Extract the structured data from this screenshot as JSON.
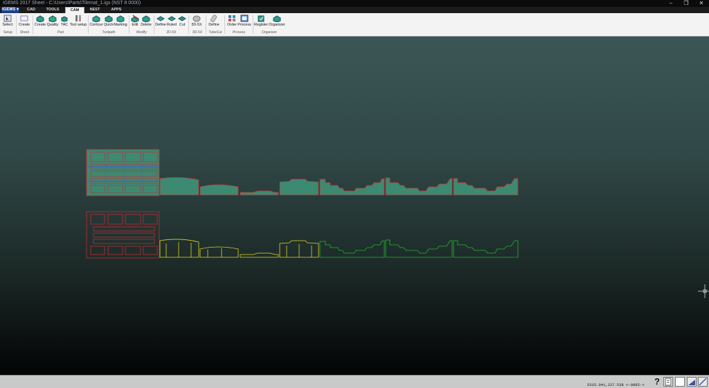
{
  "titlebar": {
    "title": "IGEMS 2017 Sheet - C:\\Users\\Parts\\Tilemat_1.igs (NST 8 0000)",
    "controls": [
      "–",
      "❐",
      "✕"
    ]
  },
  "app_menu": {
    "label": "IGEMS ▾"
  },
  "tabs": [
    "CAD",
    "TOOLS",
    "CAM",
    "NEST",
    "APPS"
  ],
  "active_tab": "CAM",
  "ribbon": {
    "buttons": {
      "select": "Select",
      "create_sheet": "Create",
      "create_part": "Create",
      "quality": "Quality",
      "tac": "TAC",
      "tool_setup": "Tool setup",
      "contour": "Contour",
      "quick": "Quick",
      "marking": "Marking",
      "edit": "Edit",
      "delete": "Delete",
      "define_2d5x": "Define",
      "ruled": "Ruled",
      "cut": "Cut",
      "threed_5x": "3D-5X",
      "define_tubecut": "Define",
      "order": "Order",
      "process": "Process",
      "register": "Register",
      "organizer": "Organizer"
    },
    "groups": {
      "setup": "Setup",
      "sheet": "Sheet",
      "part": "Part",
      "toolpath": "Toolpath",
      "modify": "Modify",
      "g2d5x": "2D-5X",
      "g3d5x": "3D-5X",
      "tubecut": "TubeCut",
      "process": "Process",
      "organizer": "Organizer"
    }
  },
  "statusbar": {
    "coords": "5315.041,227.538 <-0085->",
    "help": "?"
  },
  "colors": {
    "fill": "#3d8a72",
    "outline_red": "#c8282d",
    "yellow": "#e2d81f",
    "green": "#20b82a",
    "blue": "#3a62c8",
    "magenta": "#c03aa0"
  }
}
